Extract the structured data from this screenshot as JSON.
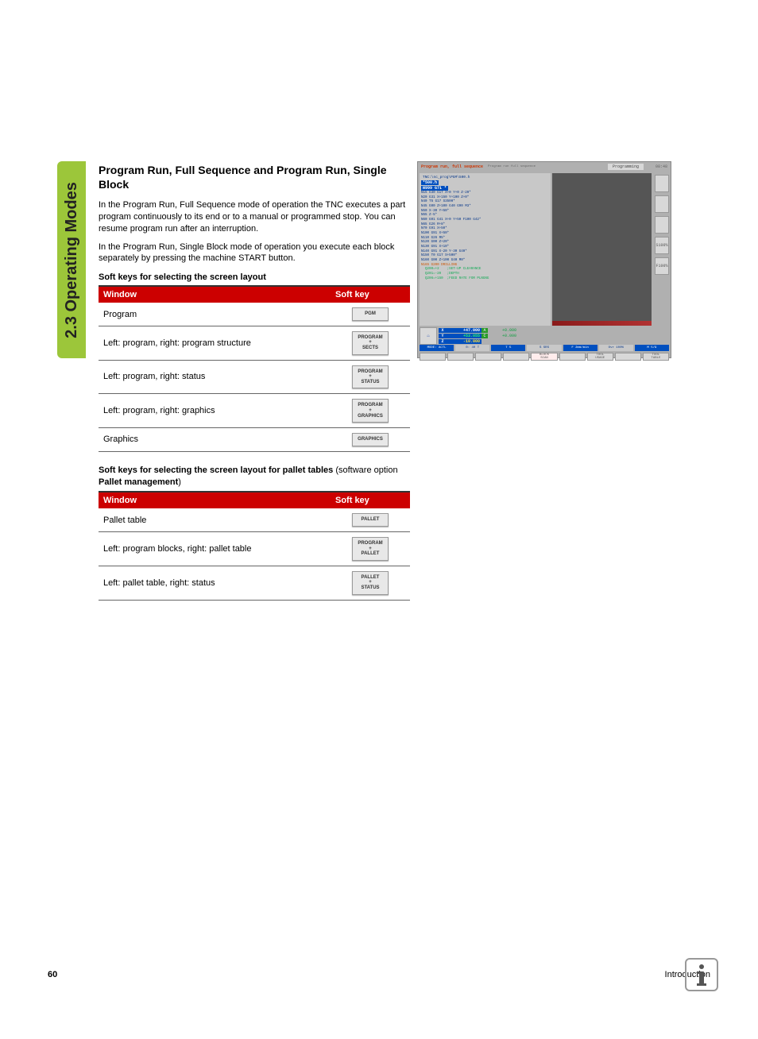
{
  "sidebar": {
    "label": "2.3 Operating Modes"
  },
  "heading": "Program Run, Full Sequence and Program Run, Single Block",
  "para1": "In the Program Run, Full Sequence mode of operation the TNC executes a part program continuously to its end or to a manual or programmed stop. You can resume program run after an interruption.",
  "para2": "In the Program Run, Single Block mode of operation you execute each block separately by pressing the machine START button.",
  "subhead1": "Soft keys for selecting the screen layout",
  "table1": {
    "headers": [
      "Window",
      "Soft key"
    ],
    "rows": [
      {
        "window": "Program",
        "key": "PGM"
      },
      {
        "window": "Left: program, right: program structure",
        "key": "PROGRAM\n+\nSECTS"
      },
      {
        "window": "Left: program, right: status",
        "key": "PROGRAM\n+\nSTATUS"
      },
      {
        "window": "Left: program, right: graphics",
        "key": "PROGRAM\n+\nGRAPHICS"
      },
      {
        "window": "Graphics",
        "key": "GRAPHICS"
      }
    ]
  },
  "caption2_a": "Soft keys for selecting the screen layout for pallet tables",
  "caption2_b": " (software option ",
  "caption2_c": "Pallet management",
  "caption2_d": ")",
  "table2": {
    "headers": [
      "Window",
      "Soft key"
    ],
    "rows": [
      {
        "window": "Pallet table",
        "key": "PALLET"
      },
      {
        "window": "Left: program blocks, right: pallet table",
        "key": "PROGRAM\n+\nPALLET"
      },
      {
        "window": "Left: pallet table, right: status",
        "key": "PALLET\n+\nSTATUS"
      }
    ]
  },
  "footer": {
    "page": "60",
    "chapter": "Introduction"
  },
  "screenshot": {
    "title_main": "Program run, full sequence",
    "title_sub": "Program run full sequence",
    "title_right": "Programming",
    "corner": "08:48",
    "prog_path": "TNC:\\nc_prog\\PGM\\500.h",
    "hl1": "*500.h",
    "hl2": "N999 G71 *",
    "lines": [
      "N15 G30 G17 X+0 Y+0 Z-20*",
      "N20 G31 X+150 Y+100 Z+0*",
      "N40 T5 G17 S3500*",
      "N45 G00 Z+100 G40 G90 M3*",
      "N50 X-30 Y+50*",
      "N55 Z-5*",
      "N60 G01 G41 X+0 Y+50 F100 G42*",
      "N65 G26 R+8*",
      "N70 G91 X+50*",
      "N100 G91 X+50*",
      "N110 G26 R5*",
      "N120 G00 Z+20*",
      "N130 G91 X+10*",
      "N140 G91 X-20 Y-30 G40*",
      "N150 T0 G17 S+500*",
      "N160 G00 Z+100 G40 M0*",
      "N165 G200 DRILLING"
    ],
    "q_lines": [
      "  Q200=+2    ;SET-UP CLEARANCE",
      "  Q201=-20   ;DEPTH",
      "  Q206=+150  ;FEED RATE FOR PLNGNG"
    ],
    "coords": {
      "x": {
        "axis": "X",
        "value": "+47.000",
        "suffix": "A",
        "extra": "+0.000"
      },
      "y": {
        "axis": "Y",
        "value": "+53.055",
        "suffix": "C",
        "extra": "+0.000"
      },
      "z": {
        "axis": "Z",
        "value": "-10.000"
      }
    },
    "status": [
      "MODE: ACTL",
      "0: 40 T",
      "T 5",
      "S SRS",
      "F 2mm/min",
      "Ovr 100%",
      "M 5/9"
    ],
    "side_labels": [
      "",
      "",
      "",
      "S100%",
      "F100%"
    ],
    "bottom": [
      "",
      "",
      "",
      "",
      "BLOCK\nSCAN",
      "",
      "TOOL\nUSAGE",
      "",
      "TOOL\nTABLE"
    ]
  }
}
